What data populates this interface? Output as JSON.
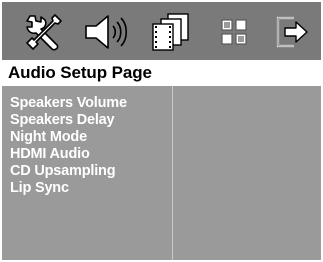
{
  "toolbar": {
    "icons": [
      {
        "name": "general-setup",
        "icon": "tools-icon"
      },
      {
        "name": "audio-setup",
        "icon": "speaker-icon"
      },
      {
        "name": "video-setup",
        "icon": "film-icon"
      },
      {
        "name": "preference-setup",
        "icon": "preference-grid-icon"
      },
      {
        "name": "exit",
        "icon": "exit-icon"
      }
    ]
  },
  "page": {
    "title": "Audio Setup Page"
  },
  "menu": {
    "items": [
      "Speakers Volume",
      "Speakers Delay",
      "Night Mode",
      "HDMI Audio",
      "CD Upsampling",
      "Lip Sync"
    ]
  },
  "colors": {
    "toolbar_bg": "#7a7a7a",
    "content_bg": "#9a9a9a",
    "icon_fill": "#ffffff",
    "text_light": "#ffffff",
    "text_dark": "#000000"
  }
}
